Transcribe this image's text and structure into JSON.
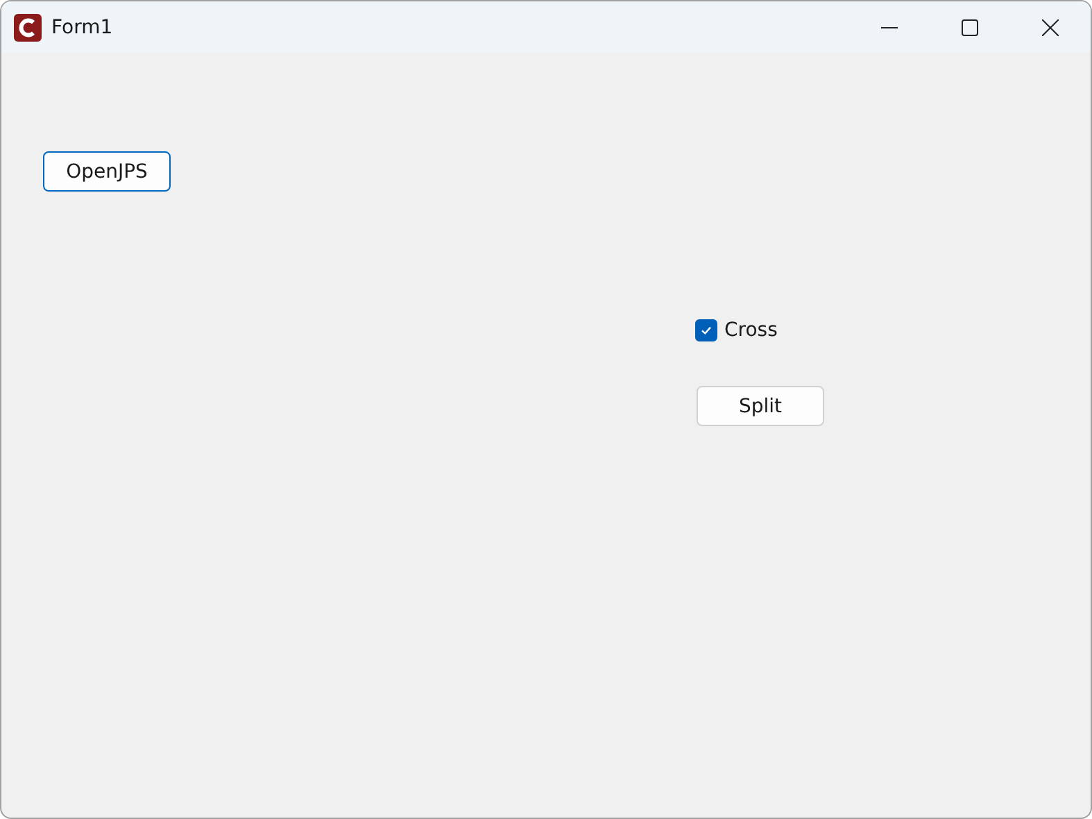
{
  "window": {
    "title": "Form1"
  },
  "open_button": {
    "label": "OpenJPS"
  },
  "checkbox": {
    "label": "Cross",
    "checked": true
  },
  "split_button": {
    "label": "Split"
  }
}
